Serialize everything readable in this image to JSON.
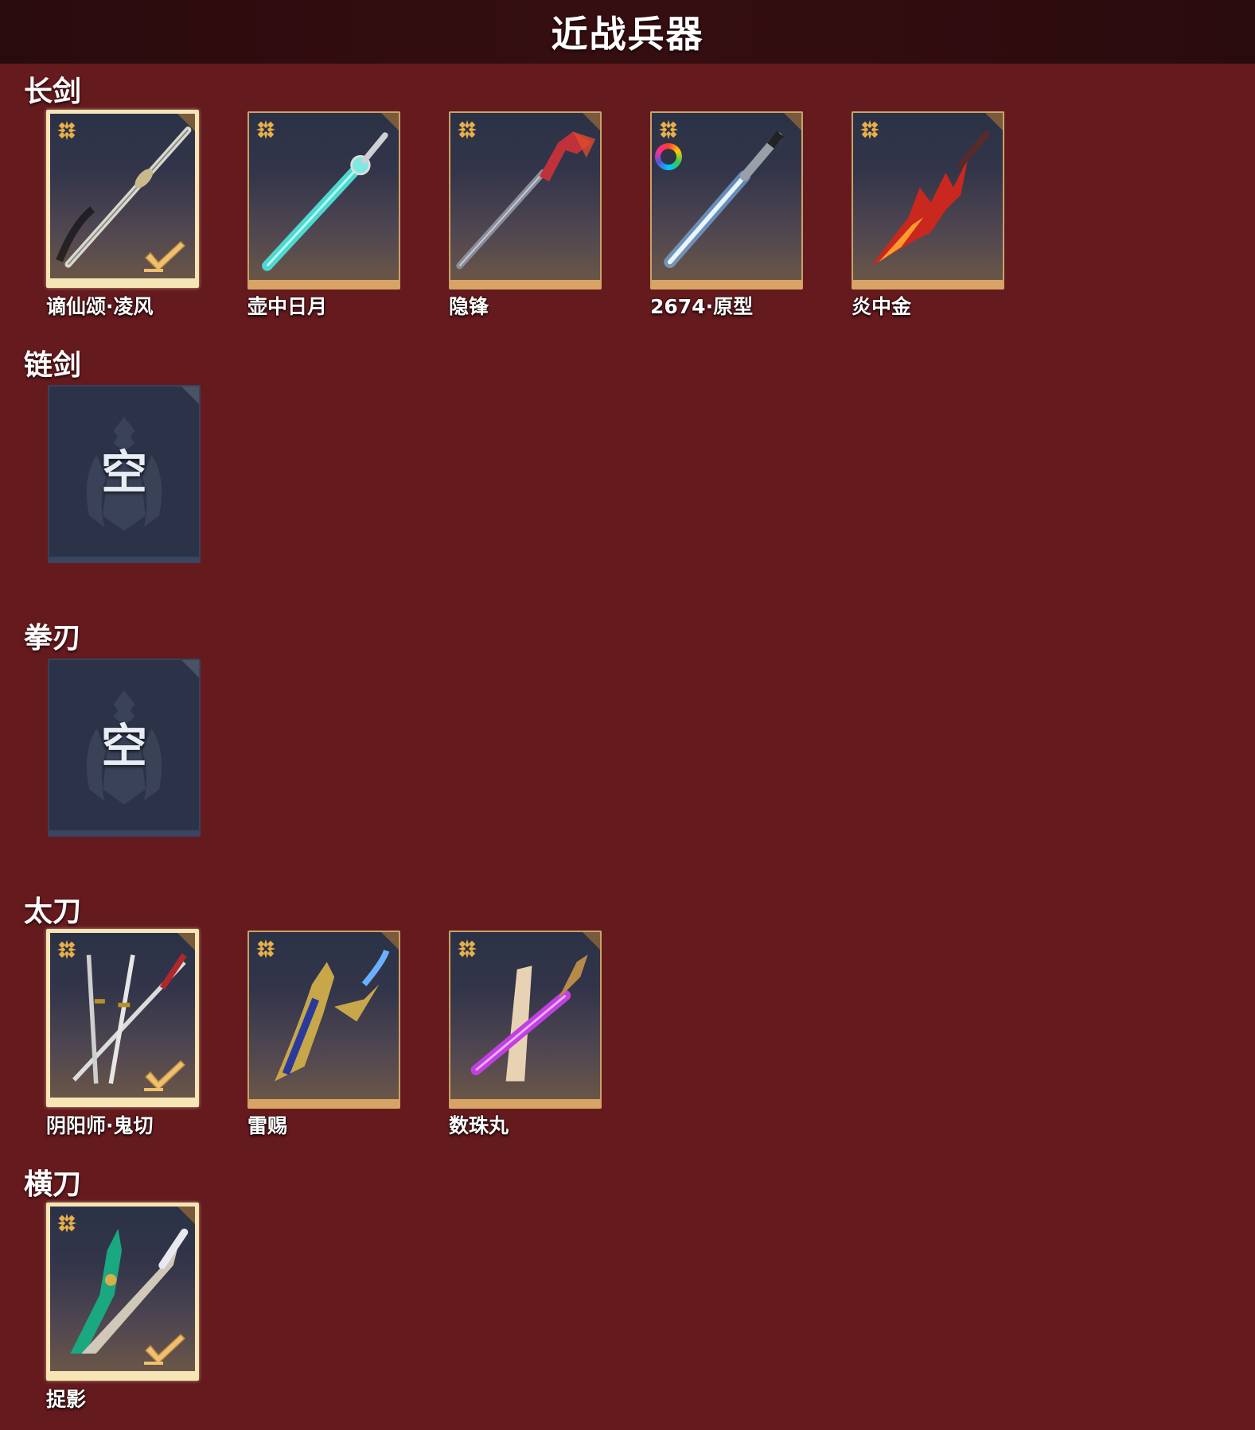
{
  "header": {
    "title": "近战兵器"
  },
  "sections": [
    {
      "label": "长剑",
      "items": [
        {
          "name": "谪仙颂·凌风",
          "selected": true,
          "star_icon": "star-badge-icon",
          "check_icon": "checkmark-icon"
        },
        {
          "name": "壶中日月",
          "selected": false,
          "star_icon": "star-badge-icon"
        },
        {
          "name": "隐锋",
          "selected": false,
          "star_icon": "star-badge-icon"
        },
        {
          "name": "2674·原型",
          "selected": false,
          "star_icon": "star-badge-icon",
          "extra_icon": "color-wheel-icon"
        },
        {
          "name": "炎中金",
          "selected": false,
          "star_icon": "star-badge-icon"
        }
      ]
    },
    {
      "label": "链剑",
      "items": [
        {
          "empty": true,
          "empty_text": "空"
        }
      ]
    },
    {
      "label": "拳刃",
      "items": [
        {
          "empty": true,
          "empty_text": "空"
        }
      ]
    },
    {
      "label": "太刀",
      "items": [
        {
          "name": "阴阳师·鬼切",
          "selected": true,
          "star_icon": "star-badge-icon",
          "check_icon": "checkmark-icon"
        },
        {
          "name": "雷赐",
          "selected": false,
          "star_icon": "star-badge-icon"
        },
        {
          "name": "数珠丸",
          "selected": false,
          "star_icon": "star-badge-icon"
        }
      ]
    },
    {
      "label": "横刀",
      "items": [
        {
          "name": "捉影",
          "selected": true,
          "star_icon": "star-badge-icon",
          "check_icon": "checkmark-icon"
        }
      ]
    }
  ],
  "colors": {
    "background": "#651a1e",
    "header_bg": "#2f0d10",
    "card_border_gold": "#d8a466",
    "card_selected_border": "#f6e6b5",
    "empty_card_bg": "#2c3348",
    "star_gold": "#e8b04a",
    "check_gold": "#f0c070"
  }
}
